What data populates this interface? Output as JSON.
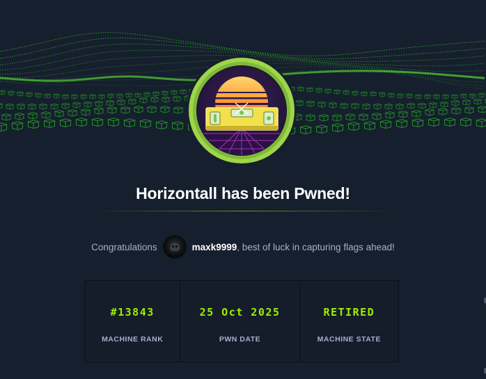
{
  "title": "Horizontall has been Pwned!",
  "congrats": {
    "prefix": "Congratulations",
    "username": "maxk9999",
    "suffix": ", best of luck in capturing flags ahead!"
  },
  "stats": [
    {
      "value": "#13843",
      "label": "MACHINE RANK"
    },
    {
      "value": "25 Oct 2025",
      "label": "PWN DATE"
    },
    {
      "value": "RETIRED",
      "label": "MACHINE STATE"
    }
  ],
  "colors": {
    "background": "#161f2d",
    "accent": "#9fef00",
    "muted_text": "#a4b1cd"
  },
  "icons": {
    "machine_badge": "horizontall-level-icon",
    "avatar": "user-avatar"
  }
}
